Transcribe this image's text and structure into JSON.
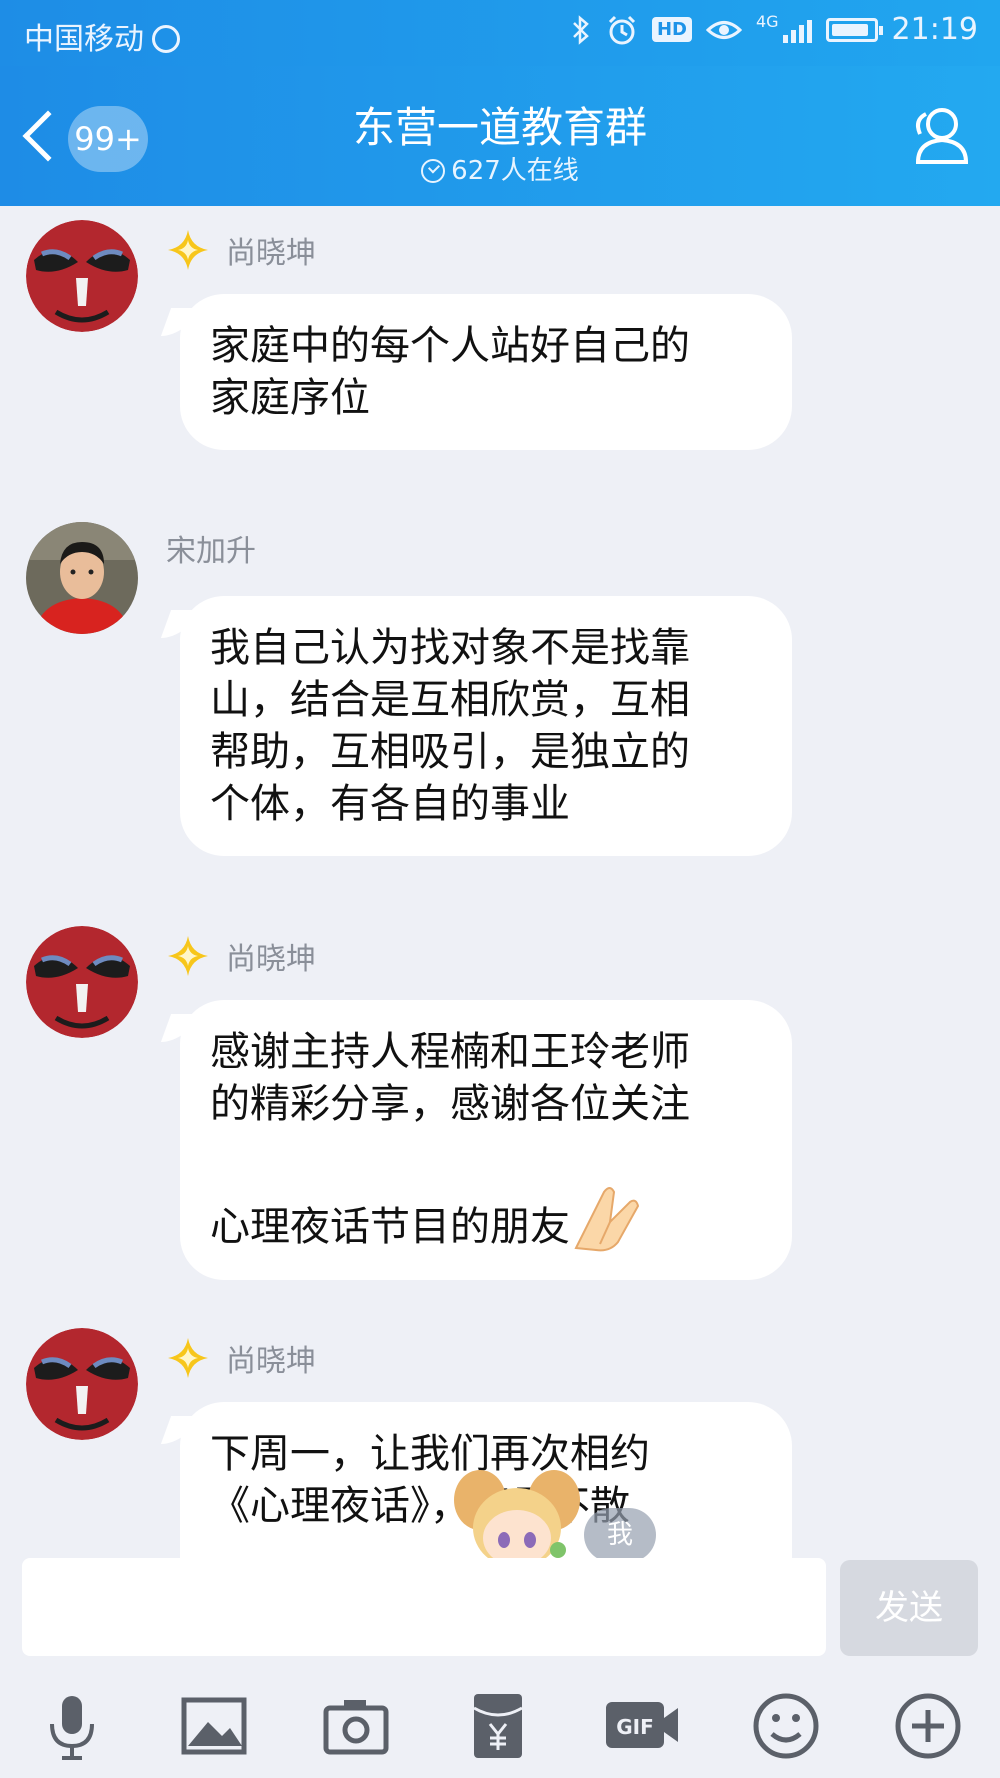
{
  "status_bar": {
    "carrier": "中国移动",
    "network": "4G",
    "hd": "HD",
    "time": "21:19"
  },
  "header": {
    "unread_badge": "99+",
    "title": "东营一道教育群",
    "online": "627人在线"
  },
  "messages": [
    {
      "sender": "尚晓坤",
      "lines": [
        "家庭中的每个人站好自己的",
        "家庭序位"
      ]
    },
    {
      "sender": "宋加升",
      "lines": [
        "我自己认为找对象不是找靠",
        "山，结合是互相欣赏，互相",
        "帮助，互相吸引，是独立的",
        "个体，有各自的事业"
      ]
    },
    {
      "sender": "尚晓坤",
      "lines": [
        " 感谢主持人程楠和王玲老师",
        "的精彩分享，感谢各位关注",
        "",
        "心理夜话节目的朋友"
      ]
    },
    {
      "sender": "尚晓坤",
      "lines": [
        "下周一，让我们再次相约",
        "《心理夜话》，不见不散"
      ]
    }
  ],
  "floating_tag": "我",
  "input": {
    "placeholder": "",
    "send_label": "发送"
  },
  "toolbar": {
    "gif_label": "GIF"
  },
  "colors": {
    "header_start": "#1e8ce6",
    "header_end": "#23a9f0",
    "background": "#eef0f6",
    "bubble": "#ffffff",
    "star": "#f7c61b",
    "send_disabled": "#d6d9e0"
  }
}
